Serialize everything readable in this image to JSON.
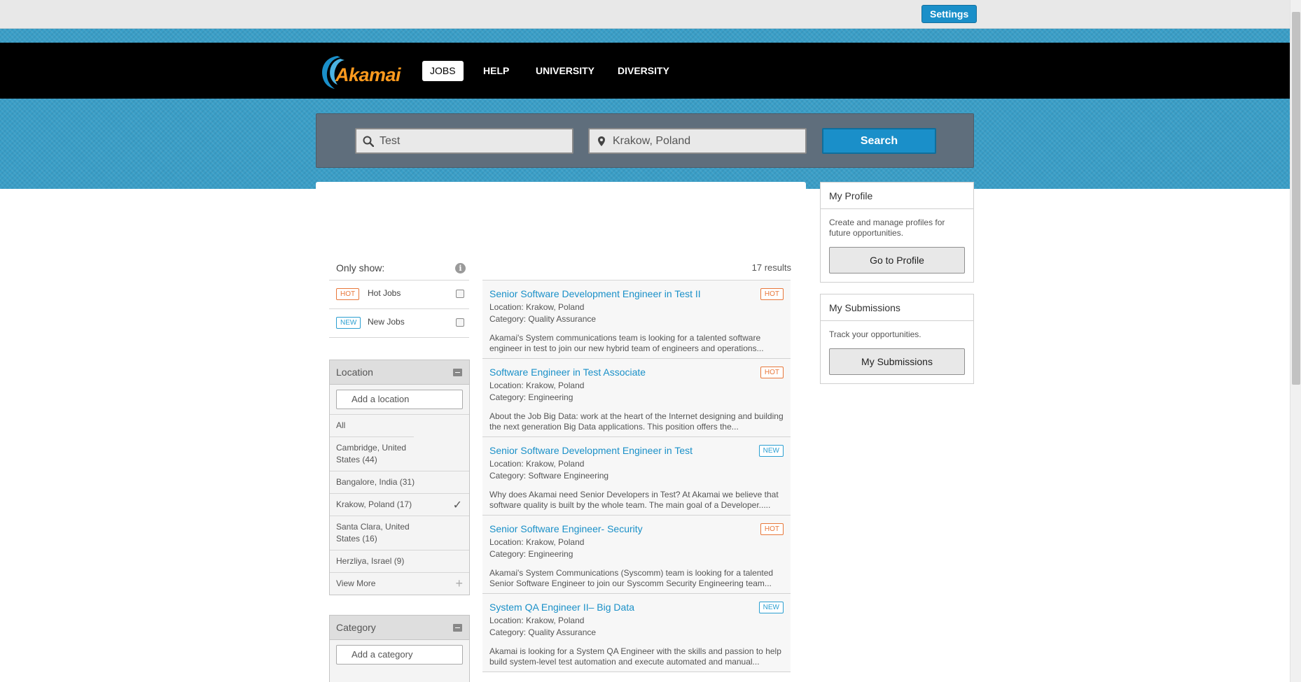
{
  "topbar": {
    "settings_label": "Settings"
  },
  "brand": {
    "logo_text": "Akamai"
  },
  "nav": {
    "items": [
      {
        "label": "JOBS",
        "active": true
      },
      {
        "label": "HELP",
        "active": false
      },
      {
        "label": "UNIVERSITY",
        "active": false
      },
      {
        "label": "DIVERSITY",
        "active": false
      }
    ]
  },
  "search": {
    "keyword_value": "Test",
    "location_value": "Krakow, Poland",
    "button_label": "Search"
  },
  "filters": {
    "only_show_title": "Only show:",
    "info_icon": "i",
    "hot": {
      "badge": "HOT",
      "label": "Hot Jobs",
      "checked": false
    },
    "new": {
      "badge": "NEW",
      "label": "New Jobs",
      "checked": false
    }
  },
  "location_facet": {
    "title": "Location",
    "input_placeholder": "Add a location",
    "items": [
      {
        "label": "All",
        "selected": false
      },
      {
        "label": "Cambridge, United States (44)",
        "selected": false
      },
      {
        "label": "Bangalore, India (31)",
        "selected": false
      },
      {
        "label": "Krakow, Poland (17)",
        "selected": true
      },
      {
        "label": "Santa Clara, United States (16)",
        "selected": false
      },
      {
        "label": "Herzliya, Israel (9)",
        "selected": false
      }
    ],
    "view_more": "View More",
    "checkmark": "✓",
    "plus": "+"
  },
  "category_facet": {
    "title": "Category",
    "input_placeholder": "Add a category"
  },
  "results": {
    "count_text": "17 results",
    "items": [
      {
        "title": "Senior Software Development Engineer in Test II",
        "badge": "HOT",
        "location": "Location: Krakow, Poland",
        "category": "Category: Quality Assurance",
        "description": "Akamai's System communications team is looking for a talented software engineer in test to join our new hybrid team of engineers and operations..."
      },
      {
        "title": "Software Engineer in Test Associate",
        "badge": "HOT",
        "location": "Location: Krakow, Poland",
        "category": "Category: Engineering",
        "description": "About the Job Big Data: work at the heart of the Internet designing and building the next generation Big Data applications. This position offers the..."
      },
      {
        "title": "Senior Software Development Engineer in Test",
        "badge": "NEW",
        "location": "Location: Krakow, Poland",
        "category": "Category: Software Engineering",
        "description": "Why does Akamai need Senior Developers in Test? At Akamai we believe that software quality is built by the whole team. The main goal of a Developer....."
      },
      {
        "title": "Senior Software Engineer- Security",
        "badge": "HOT",
        "location": "Location: Krakow, Poland",
        "category": "Category: Engineering",
        "description": "Akamai's System Communications (Syscomm) team is looking for a talented Senior Software Engineer to join our Syscomm Security Engineering team..."
      },
      {
        "title": "System QA Engineer II– Big Data",
        "badge": "NEW",
        "location": "Location: Krakow, Poland",
        "category": "Category: Quality Assurance",
        "description": "Akamai is looking for a System QA Engineer with the skills and passion to help build system-level test automation and execute automated and manual..."
      }
    ]
  },
  "sidebar": {
    "profile": {
      "title": "My Profile",
      "text": "Create and manage profiles for future opportunities.",
      "button": "Go to Profile"
    },
    "submissions": {
      "title": "My Submissions",
      "text": "Track your opportunities.",
      "button": "My Submissions"
    }
  },
  "colors": {
    "accent_blue": "#1a8fc9",
    "band_blue": "#3a9ec7",
    "hot_orange": "#e8773a",
    "new_blue": "#2b9fd1",
    "logo_orange": "#ff9a1e"
  }
}
